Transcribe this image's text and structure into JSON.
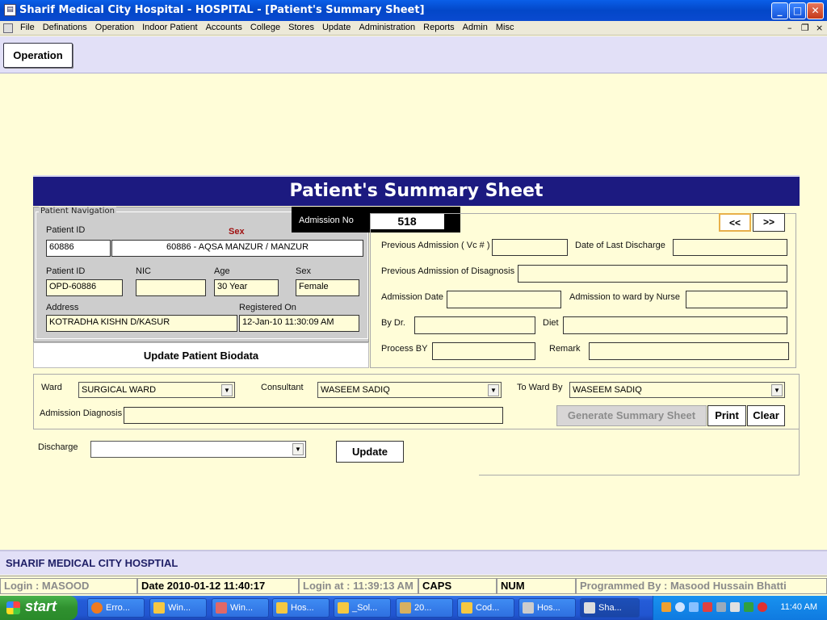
{
  "window": {
    "title": "Sharif Medical City Hospital - HOSPITAL - [Patient's Summary Sheet]",
    "minimize": "_",
    "maximize": "□",
    "close": "✕"
  },
  "menu": {
    "items": [
      "File",
      "Definations",
      "Operation",
      "Indoor Patient",
      "Accounts",
      "College",
      "Stores",
      "Update",
      "Administration",
      "Reports",
      "Admin",
      "Misc"
    ],
    "mdi_min": "–",
    "mdi_restore": "❐",
    "mdi_close": "×"
  },
  "toolbar": {
    "operation_label": "Operation"
  },
  "form": {
    "title": "Patient's Summary Sheet",
    "nav_legend": "Patient Navigation",
    "admission_no_label": "Admission No",
    "admission_no": "518",
    "patient_id_label": "Patient ID",
    "sex_header": "Sex",
    "patient_id_value": "60886",
    "patient_name_combo": "60886  -  AQSA MANZUR  /  MANZUR",
    "patient_id2_label": "Patient ID",
    "nic_label": "NIC",
    "age_label": "Age",
    "sex_label": "Sex",
    "patient_id2_value": "OPD-60886",
    "nic_value": "",
    "age_value": "30 Year",
    "sex_value": "Female",
    "address_label": "Address",
    "registered_on_label": "Registered On",
    "address_value": "KOTRADHA KISHN D/KASUR",
    "registered_on_value": "12-Jan-10 11:30:09 AM",
    "update_biodata": "Update Patient Biodata",
    "prev_btn": "<<",
    "next_btn": ">>",
    "prev_admission_label": "Previous Admission ( Vc # )",
    "date_last_discharge_label": "Date of Last Discharge",
    "prev_adm_diagnosis_label": "Previous Admission of Disagnosis",
    "admission_date_label": "Admission Date",
    "admission_ward_nurse_label": "Admission to ward by Nurse",
    "by_dr_label": "By Dr.",
    "diet_label": "Diet",
    "process_by_label": "Process BY",
    "remark_label": "Remark",
    "ward_label": "Ward",
    "ward_value": "SURGICAL WARD",
    "consultant_label": "Consultant",
    "consultant_value": "WASEEM SADIQ",
    "to_ward_by_label": "To Ward By",
    "to_ward_by_value": "WASEEM SADIQ",
    "admission_diagnosis_label": "Admission Diagnosis",
    "generate_btn": "Generate Summary Sheet",
    "print_btn": "Print",
    "clear_btn": "Clear",
    "discharge_label": "Discharge",
    "discharge_value": "",
    "update_btn": "Update"
  },
  "footer": {
    "org_name": "SHARIF MEDICAL CITY HOSPTIAL"
  },
  "status": {
    "login": "Login :  MASOOD",
    "date": "Date 2010-01-12 11:40:17",
    "login_at": "Login at : 11:39:13 AM",
    "caps": "CAPS",
    "num": "NUM",
    "programmed_by": "Programmed By : Masood Hussain Bhatti"
  },
  "taskbar": {
    "start": "start",
    "tasks": [
      "Erro...",
      "Win...",
      "Win...",
      "Hos...",
      "_Sol...",
      "20...",
      "Cod...",
      "Hos...",
      "Sha..."
    ],
    "clock": "11:40 AM"
  },
  "colors": {
    "form_bg": "#fffdd8",
    "header_bg": "#1c1a80",
    "toolbar_bg": "#e2e0f7",
    "panel_gray": "#cdcdcd"
  }
}
